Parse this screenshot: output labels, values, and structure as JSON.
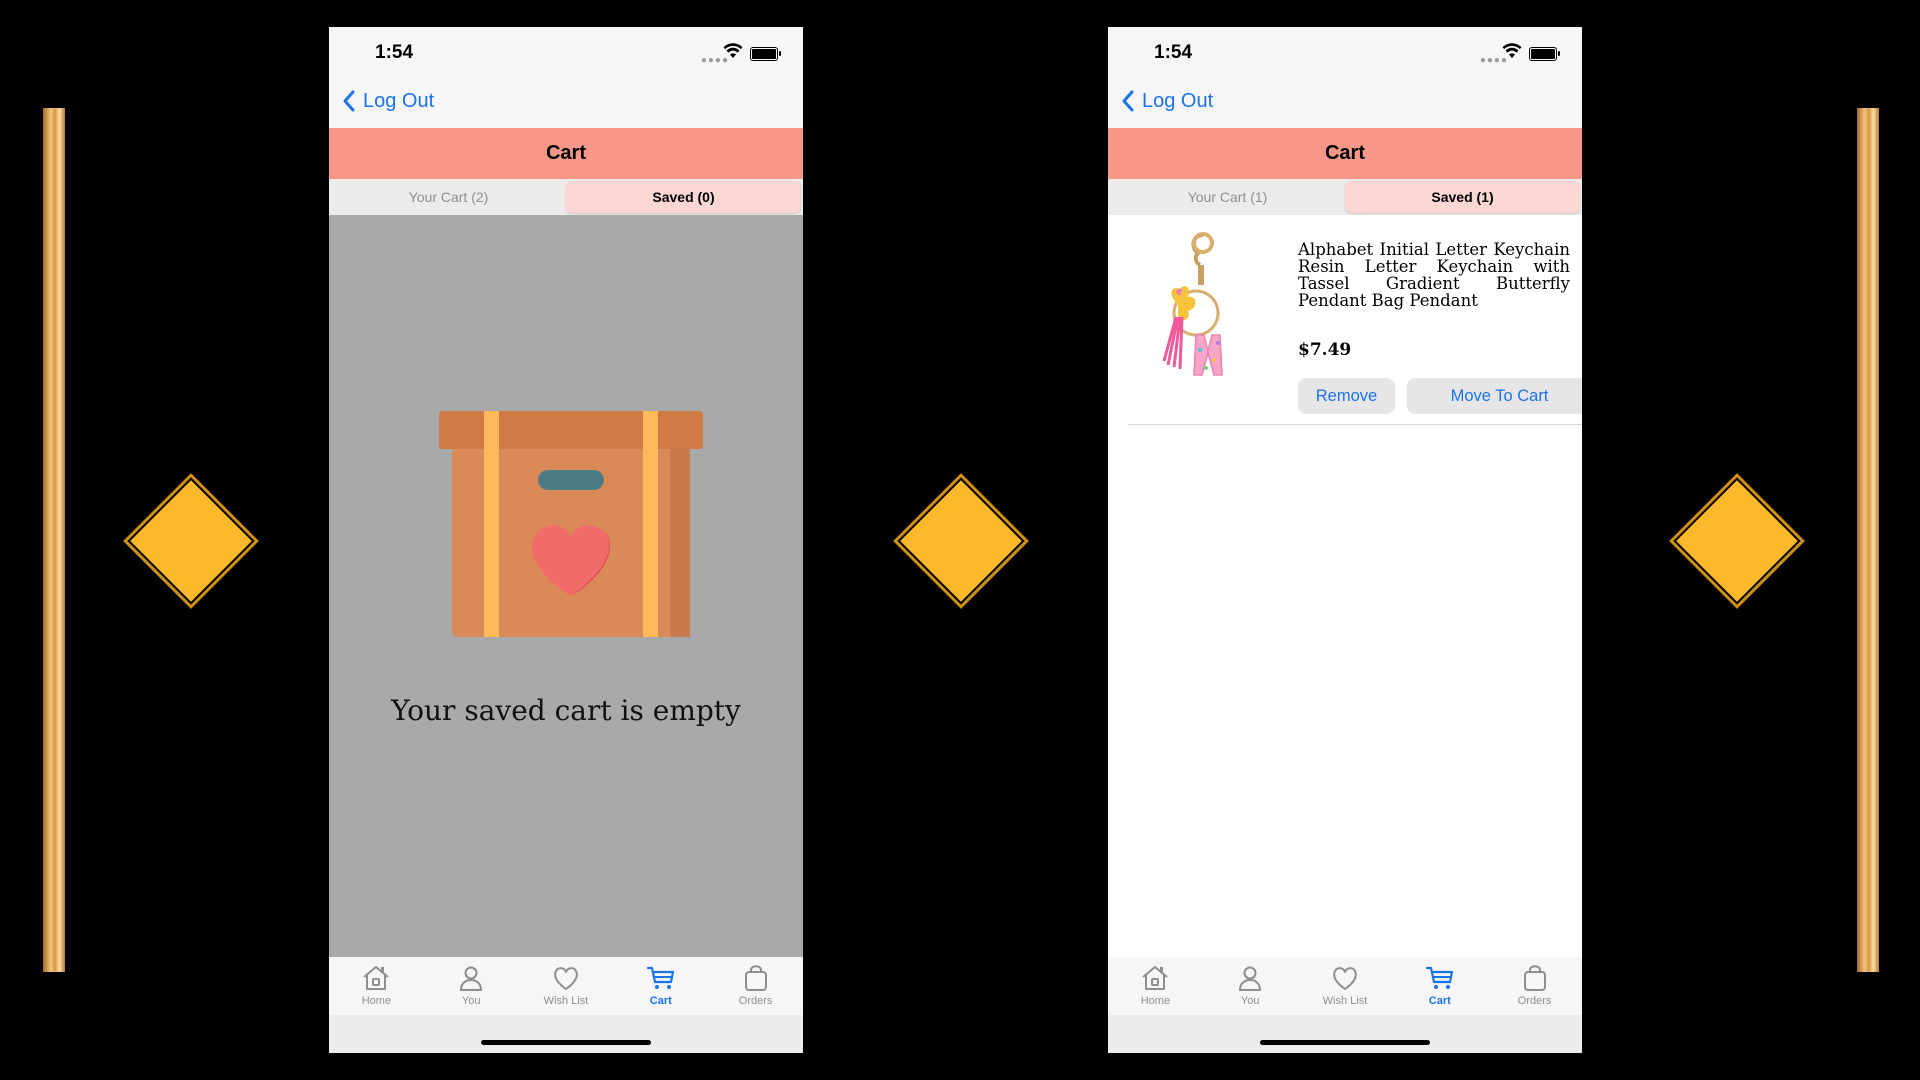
{
  "colors": {
    "accent": "#1a73e8",
    "header": "#f6978a",
    "diamond": "#fcb82a"
  },
  "screens": [
    {
      "status": {
        "time": "1:54"
      },
      "nav": {
        "back_label": "Log Out"
      },
      "header": {
        "title": "Cart"
      },
      "segments": [
        {
          "label": "Your Cart (2)",
          "active": false
        },
        {
          "label": "Saved (0)",
          "active": true
        }
      ],
      "empty": {
        "message": "Your saved cart is empty"
      },
      "tabbar": [
        {
          "label": "Home",
          "icon": "home-icon",
          "active": false
        },
        {
          "label": "You",
          "icon": "person-icon",
          "active": false
        },
        {
          "label": "Wish List",
          "icon": "heart-icon",
          "active": false
        },
        {
          "label": "Cart",
          "icon": "cart-icon",
          "active": true
        },
        {
          "label": "Orders",
          "icon": "bag-icon",
          "active": false
        }
      ]
    },
    {
      "status": {
        "time": "1:54"
      },
      "nav": {
        "back_label": "Log Out"
      },
      "header": {
        "title": "Cart"
      },
      "segments": [
        {
          "label": "Your Cart (1)",
          "active": false
        },
        {
          "label": "Saved (1)",
          "active": true
        }
      ],
      "items": [
        {
          "title": "Alphabet Initial Letter Keychain Resin Letter Keychain with Tassel Gradient Butterfly Pendant Bag Pendant",
          "price": "$7.49",
          "remove_label": "Remove",
          "move_label": "Move To Cart"
        }
      ],
      "tabbar": [
        {
          "label": "Home",
          "icon": "home-icon",
          "active": false
        },
        {
          "label": "You",
          "icon": "person-icon",
          "active": false
        },
        {
          "label": "Wish List",
          "icon": "heart-icon",
          "active": false
        },
        {
          "label": "Cart",
          "icon": "cart-icon",
          "active": true
        },
        {
          "label": "Orders",
          "icon": "bag-icon",
          "active": false
        }
      ]
    }
  ]
}
